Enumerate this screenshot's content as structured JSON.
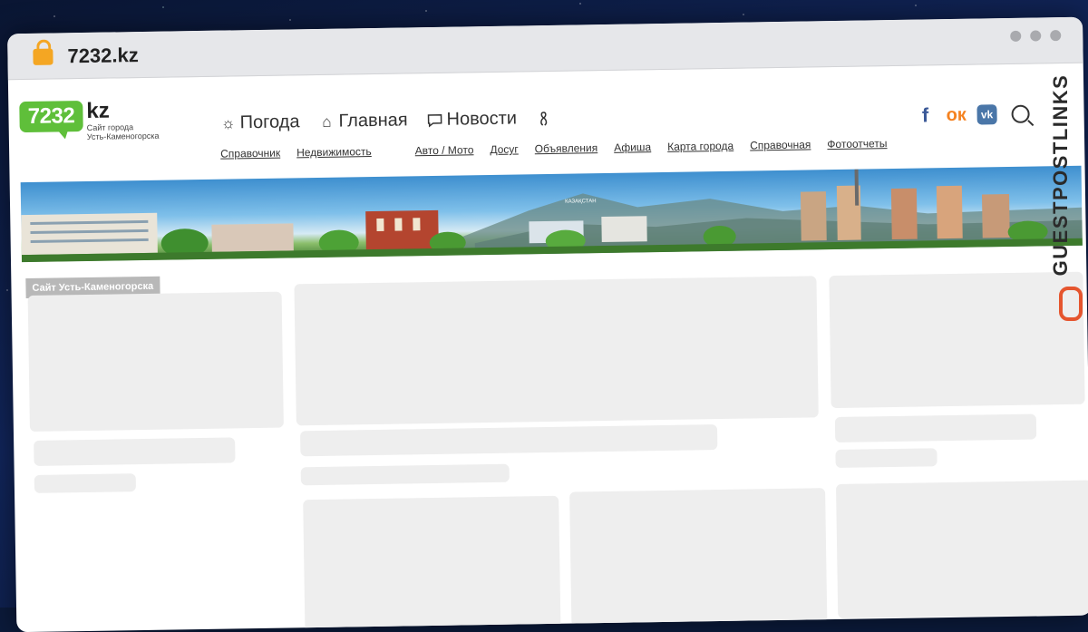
{
  "browser": {
    "url": "7232.kz"
  },
  "logo": {
    "number": "7232",
    "kz": "kz",
    "sub_line1": "Сайт города",
    "sub_line2": "Усть-Каменогорска"
  },
  "main_nav": {
    "weather": "Погода",
    "home": "Главная",
    "news": "Новости"
  },
  "sub_nav": [
    "Справочник",
    "Недвижимость",
    "Авто / Мото",
    "Досуг",
    "Объявления",
    "Афиша",
    "Карта города",
    "Справочная",
    "Фотоотчеты"
  ],
  "banner_sign": "КАЗАҚСТАН",
  "section_tag": "Сайт Усть-Каменогорска",
  "watermark": "GUESTPOSTLINKS",
  "colors": {
    "logo_green": "#5fbf3a",
    "facebook": "#3b5998",
    "odnoklassniki": "#f58220",
    "vk": "#4a76a8",
    "lock": "#f4a623",
    "watermark_accent": "#e5552e"
  },
  "icons": [
    "lock-icon",
    "sun-icon",
    "home-icon",
    "chat-icon",
    "ribbon-icon",
    "facebook-icon",
    "odnoklassniki-icon",
    "vk-icon",
    "search-icon",
    "chain-link-icon"
  ]
}
